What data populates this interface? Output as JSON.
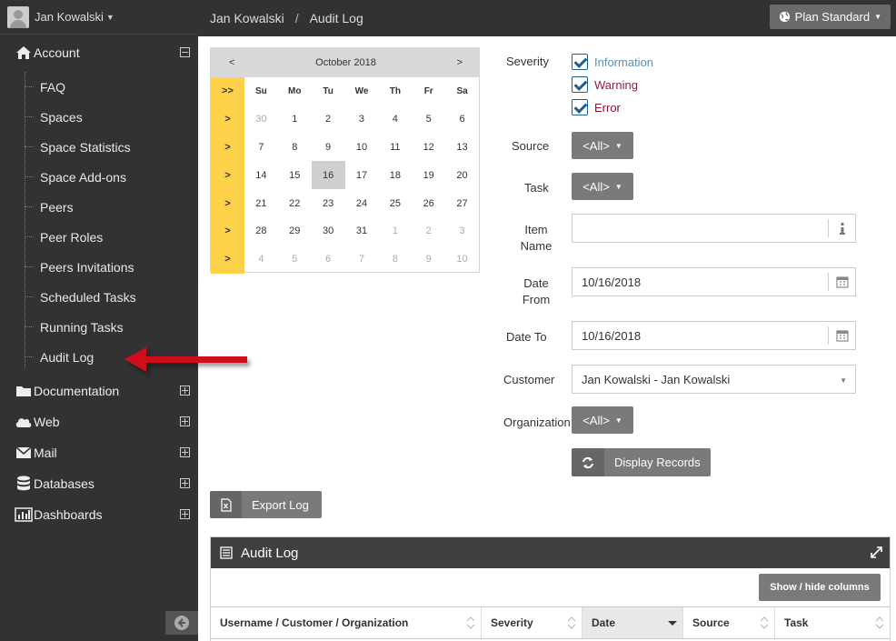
{
  "user": {
    "name": "Jan Kowalski"
  },
  "sidebar": {
    "account_label": "Account",
    "sub_items": [
      "FAQ",
      "Spaces",
      "Space Statistics",
      "Space Add-ons",
      "Peers",
      "Peer Roles",
      "Peers Invitations",
      "Scheduled Tasks",
      "Running Tasks",
      "Audit Log"
    ],
    "sections": [
      {
        "label": "Documentation",
        "icon": "folder-icon"
      },
      {
        "label": "Web",
        "icon": "cloud-icon"
      },
      {
        "label": "Mail",
        "icon": "envelope-icon"
      },
      {
        "label": "Databases",
        "icon": "database-icon"
      },
      {
        "label": "Dashboards",
        "icon": "bar-chart-icon"
      }
    ]
  },
  "header": {
    "breadcrumb_user": "Jan Kowalski",
    "breadcrumb_sep": "/",
    "breadcrumb_page": "Audit Log",
    "plan_label": "Plan Standard"
  },
  "calendar": {
    "prev": "<",
    "next": ">",
    "month": "October 2018",
    "week_all": ">>",
    "week_marker": ">",
    "days": [
      "Su",
      "Mo",
      "Tu",
      "We",
      "Th",
      "Fr",
      "Sa"
    ],
    "weeks": [
      [
        "30",
        "1",
        "2",
        "3",
        "4",
        "5",
        "6"
      ],
      [
        "7",
        "8",
        "9",
        "10",
        "11",
        "12",
        "13"
      ],
      [
        "14",
        "15",
        "16",
        "17",
        "18",
        "19",
        "20"
      ],
      [
        "21",
        "22",
        "23",
        "24",
        "25",
        "26",
        "27"
      ],
      [
        "28",
        "29",
        "30",
        "31",
        "1",
        "2",
        "3"
      ],
      [
        "4",
        "5",
        "6",
        "7",
        "8",
        "9",
        "10"
      ]
    ],
    "selected": "16"
  },
  "form": {
    "severity_label": "Severity",
    "severity_options": [
      {
        "label": "Information",
        "color": "#5a8fb3",
        "checked": true
      },
      {
        "label": "Warning",
        "color": "#a0183a",
        "checked": true
      },
      {
        "label": "Error",
        "color": "#8a1030",
        "checked": true
      }
    ],
    "source_label": "Source",
    "source_value": "<All>",
    "task_label": "Task",
    "task_value": "<All>",
    "item_name_label_1": "Item",
    "item_name_label_2": "Name",
    "item_name_value": "",
    "date_from_label_1": "Date",
    "date_from_label_2": "From",
    "date_from_value": "10/16/2018",
    "date_to_label": "Date To",
    "date_to_value": "10/16/2018",
    "customer_label": "Customer",
    "customer_value": "Jan Kowalski - Jan Kowalski",
    "organization_label": "Organization",
    "organization_value": "<All>",
    "display_label": "Display Records"
  },
  "export_label": "Export Log",
  "panel": {
    "title": "Audit Log",
    "show_hide_label": "Show / hide columns",
    "columns": [
      "Username / Customer / Organization",
      "Severity",
      "Date",
      "Source",
      "Task"
    ]
  },
  "colors": {
    "sidebar_bg": "#323232",
    "calendar_week": "#fdd14a",
    "annotation_arrow": "#d0101a"
  }
}
